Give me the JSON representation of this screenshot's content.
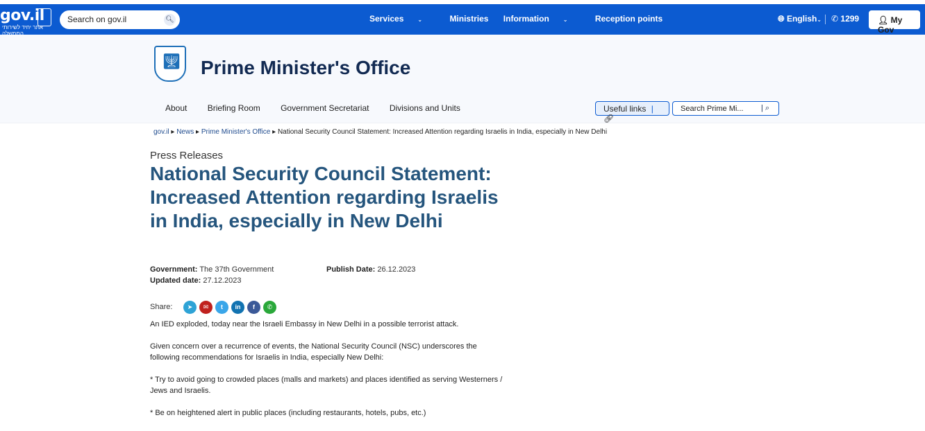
{
  "topbar": {
    "logo_text": "gov.il",
    "logo_sub": "אתר יחיד לשירותי הממשלה",
    "search_placeholder": "Search on gov.il",
    "nav": [
      {
        "label": "Services",
        "chevron": "⌄"
      },
      {
        "label": "Ministries"
      },
      {
        "label": "Information",
        "chevron": "⌄"
      },
      {
        "label": "Reception points"
      }
    ],
    "language": "English",
    "language_chevron": "⌄",
    "phone": "1299",
    "mygov": "My Gov",
    "colors": {
      "bar": "#0c5bd1"
    }
  },
  "header": {
    "site_title": "Prime Minister's Office",
    "subnav": [
      "About",
      "Briefing Room",
      "Government Secretariat",
      "Divisions and Units"
    ],
    "useful_links": "Useful links",
    "search_placeholder": "Search Prime Mi..."
  },
  "breadcrumb": [
    {
      "label": "gov.il"
    },
    {
      "label": "News"
    },
    {
      "label": "Prime Minister's Office"
    },
    {
      "label": "National Security Council Statement: Increased Attention regarding Israelis in India, especially in New Delhi"
    }
  ],
  "article": {
    "kicker": "Press Releases",
    "title": "National Security Council Statement: Increased Attention regarding Israelis in India, especially in New Delhi",
    "government_label": "Government:",
    "government_value": "The 37th Government",
    "publish_label": "Publish Date:",
    "publish_value": "26.12.2023",
    "updated_label": "Updated date:",
    "updated_value": "27.12.2023",
    "share_label": "Share:",
    "paragraphs": [
      "An IED exploded, today near the Israeli Embassy in New Delhi in a possible terrorist attack.",
      "Given concern over a recurrence of events, the National Security Council (NSC) underscores the following recommendations for Israelis in India, especially New Delhi:",
      "* Try to avoid going to crowded places (malls and markets) and places identified as serving Westerners / Jews and Israelis.",
      "* Be on heightened alert in public places (including restaurants, hotels, pubs, etc.)"
    ]
  },
  "share_icons": [
    {
      "name": "telegram-icon",
      "glyph": "➤",
      "color": "#2ea3d6"
    },
    {
      "name": "email-icon",
      "glyph": "✉",
      "color": "#c0211e"
    },
    {
      "name": "twitter-icon",
      "glyph": "t",
      "color": "#3aa6e9"
    },
    {
      "name": "linkedin-icon",
      "glyph": "in",
      "color": "#1273b1"
    },
    {
      "name": "facebook-icon",
      "glyph": "f",
      "color": "#3b5998"
    },
    {
      "name": "whatsapp-icon",
      "glyph": "✆",
      "color": "#2aa83a"
    }
  ]
}
